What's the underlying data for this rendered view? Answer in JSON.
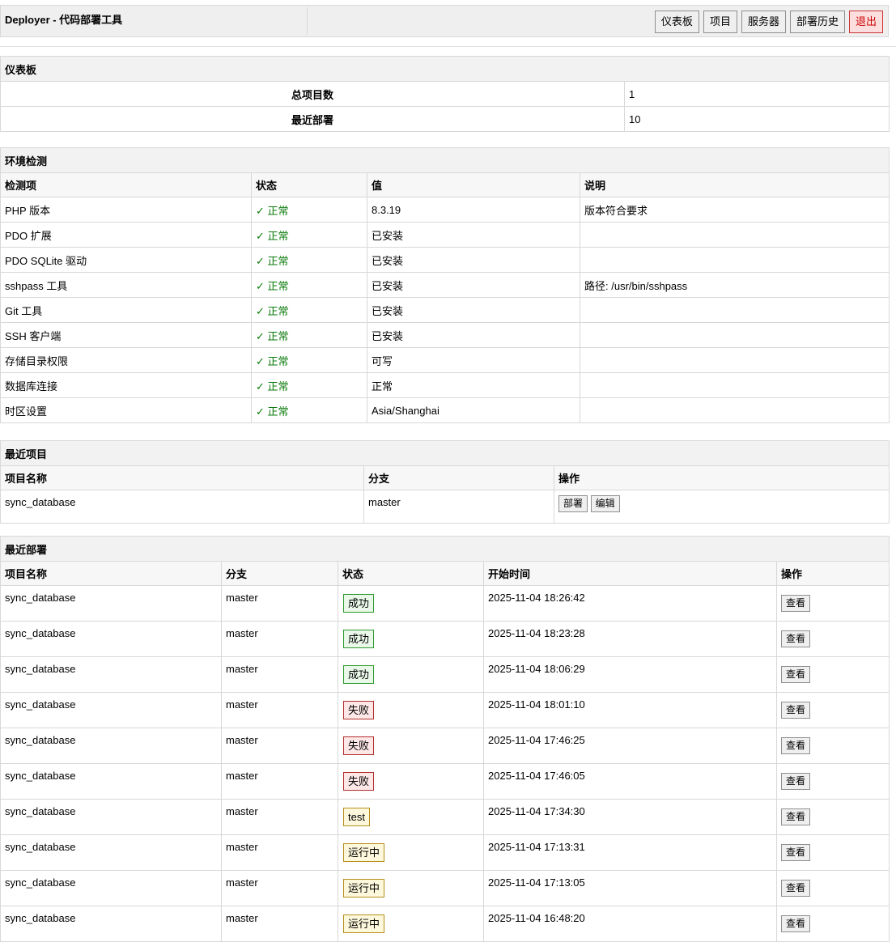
{
  "header": {
    "title": "Deployer - 代码部署工具",
    "nav": [
      "仪表板",
      "项目",
      "服务器",
      "部署历史"
    ],
    "logout": "退出"
  },
  "dashboard": {
    "title": "仪表板",
    "rows": [
      {
        "label": "总项目数",
        "value": "1"
      },
      {
        "label": "最近部署",
        "value": "10"
      }
    ]
  },
  "env": {
    "title": "环境检测",
    "headers": [
      "检测项",
      "状态",
      "值",
      "说明"
    ],
    "status_ok": "✓ 正常",
    "rows": [
      {
        "item": "PHP 版本",
        "status": "✓ 正常",
        "value": "8.3.19",
        "note": "版本符合要求"
      },
      {
        "item": "PDO 扩展",
        "status": "✓ 正常",
        "value": "已安装",
        "note": ""
      },
      {
        "item": "PDO SQLite 驱动",
        "status": "✓ 正常",
        "value": "已安装",
        "note": ""
      },
      {
        "item": "sshpass 工具",
        "status": "✓ 正常",
        "value": "已安装",
        "note": "路径: /usr/bin/sshpass"
      },
      {
        "item": "Git 工具",
        "status": "✓ 正常",
        "value": "已安装",
        "note": ""
      },
      {
        "item": "SSH 客户端",
        "status": "✓ 正常",
        "value": "已安装",
        "note": ""
      },
      {
        "item": "存储目录权限",
        "status": "✓ 正常",
        "value": "可写",
        "note": ""
      },
      {
        "item": "数据库连接",
        "status": "✓ 正常",
        "value": "正常",
        "note": ""
      },
      {
        "item": "时区设置",
        "status": "✓ 正常",
        "value": "Asia/Shanghai",
        "note": ""
      }
    ]
  },
  "recent_projects": {
    "title": "最近项目",
    "headers": [
      "项目名称",
      "分支",
      "操作"
    ],
    "rows": [
      {
        "name": "sync_database",
        "branch": "master",
        "deploy": "部署",
        "edit": "编辑"
      }
    ]
  },
  "recent_deploys": {
    "title": "最近部署",
    "headers": [
      "项目名称",
      "分支",
      "状态",
      "开始时间",
      "操作"
    ],
    "view_label": "查看",
    "rows": [
      {
        "name": "sync_database",
        "branch": "master",
        "status": "成功",
        "status_type": "success",
        "time": "2025-11-04 18:26:42"
      },
      {
        "name": "sync_database",
        "branch": "master",
        "status": "成功",
        "status_type": "success",
        "time": "2025-11-04 18:23:28"
      },
      {
        "name": "sync_database",
        "branch": "master",
        "status": "成功",
        "status_type": "success",
        "time": "2025-11-04 18:06:29"
      },
      {
        "name": "sync_database",
        "branch": "master",
        "status": "失败",
        "status_type": "failed",
        "time": "2025-11-04 18:01:10"
      },
      {
        "name": "sync_database",
        "branch": "master",
        "status": "失败",
        "status_type": "failed",
        "time": "2025-11-04 17:46:25"
      },
      {
        "name": "sync_database",
        "branch": "master",
        "status": "失败",
        "status_type": "failed",
        "time": "2025-11-04 17:46:05"
      },
      {
        "name": "sync_database",
        "branch": "master",
        "status": "test",
        "status_type": "test",
        "time": "2025-11-04 17:34:30"
      },
      {
        "name": "sync_database",
        "branch": "master",
        "status": "运行中",
        "status_type": "running",
        "time": "2025-11-04 17:13:31"
      },
      {
        "name": "sync_database",
        "branch": "master",
        "status": "运行中",
        "status_type": "running",
        "time": "2025-11-04 17:13:05"
      },
      {
        "name": "sync_database",
        "branch": "master",
        "status": "运行中",
        "status_type": "running",
        "time": "2025-11-04 16:48:20"
      }
    ]
  }
}
